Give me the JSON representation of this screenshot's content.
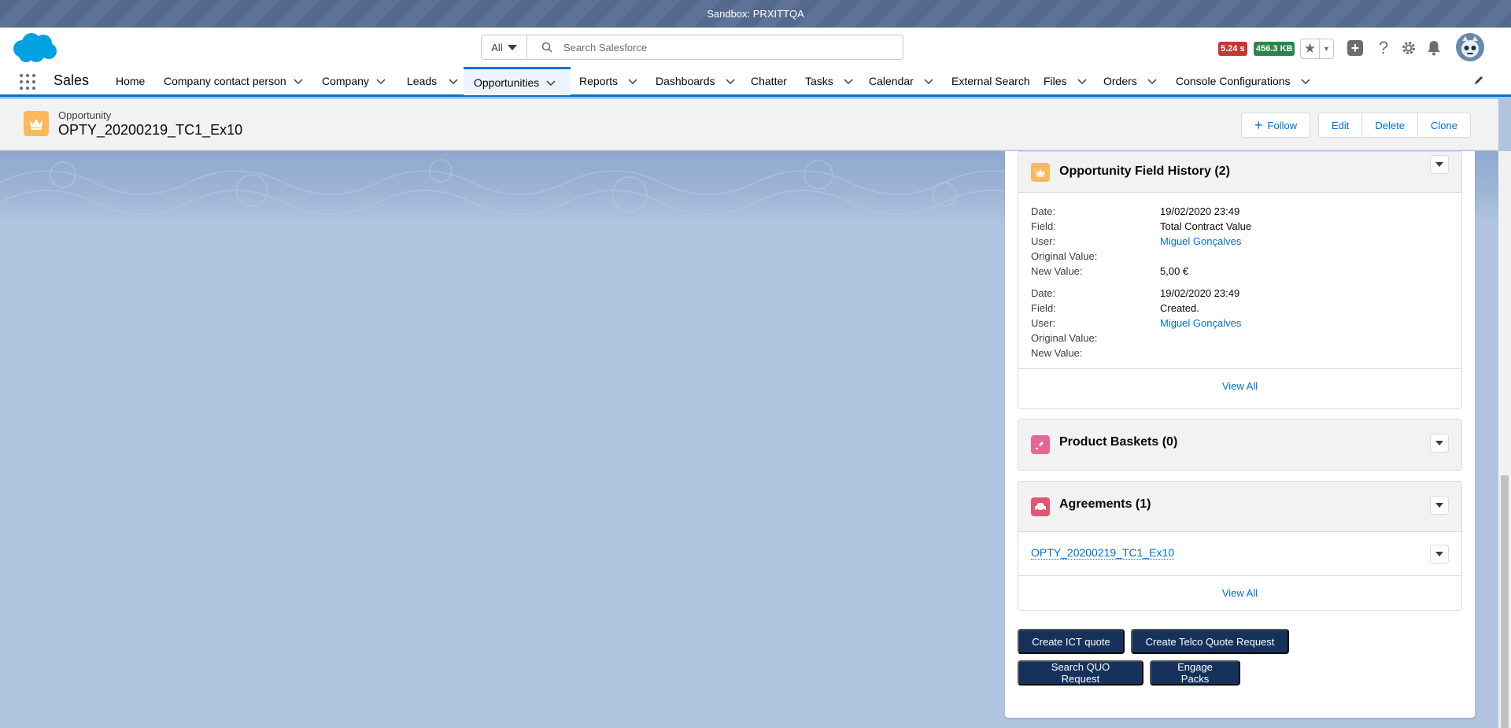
{
  "sandbox": {
    "label": "Sandbox: PRXITTQA"
  },
  "header": {
    "search_scope": "All",
    "search_placeholder": "Search Salesforce",
    "timing_badge": "5.24 s",
    "size_badge": "456.3 KB"
  },
  "nav": {
    "app_name": "Sales",
    "items": [
      {
        "label": "Home",
        "has_menu": false
      },
      {
        "label": "Company contact person",
        "has_menu": true
      },
      {
        "label": "Company",
        "has_menu": true
      },
      {
        "label": "Leads",
        "has_menu": true
      },
      {
        "label": "Opportunities",
        "has_menu": true,
        "active": true
      },
      {
        "label": "Reports",
        "has_menu": true
      },
      {
        "label": "Dashboards",
        "has_menu": true
      },
      {
        "label": "Chatter",
        "has_menu": false
      },
      {
        "label": "Tasks",
        "has_menu": true
      },
      {
        "label": "Calendar",
        "has_menu": true
      },
      {
        "label": "External Search",
        "has_menu": false
      },
      {
        "label": "Files",
        "has_menu": true
      },
      {
        "label": "Orders",
        "has_menu": true
      },
      {
        "label": "Console Configurations",
        "has_menu": true
      }
    ]
  },
  "record": {
    "object_type": "Opportunity",
    "name": "OPTY_20200219_TC1_Ex10",
    "follow_label": "Follow",
    "edit_label": "Edit",
    "delete_label": "Delete",
    "clone_label": "Clone"
  },
  "field_history": {
    "title": "Opportunity Field History (2)",
    "labels": {
      "date": "Date:",
      "field": "Field:",
      "user": "User:",
      "original": "Original Value:",
      "new": "New Value:"
    },
    "entries": [
      {
        "date": "19/02/2020 23:49",
        "field": "Total Contract Value",
        "user": "Miguel Gonçalves",
        "original": "",
        "new": "5,00 €"
      },
      {
        "date": "19/02/2020 23:49",
        "field": "Created.",
        "user": "Miguel Gonçalves",
        "original": "",
        "new": ""
      }
    ],
    "view_all": "View All"
  },
  "product_baskets": {
    "title": "Product Baskets (0)"
  },
  "agreements": {
    "title": "Agreements (1)",
    "item": "OPTY_20200219_TC1_Ex10",
    "view_all": "View All"
  },
  "actions": {
    "create_ict": "Create ICT quote",
    "create_telco": "Create Telco Quote Request",
    "search_quo": "Search QUO Request",
    "engage_packs": "Engage Packs"
  },
  "colors": {
    "brand": "#0070d2",
    "opportunity_icon": "#fcb95b",
    "basket_icon": "#e56798",
    "agreement_icon": "#e3566f",
    "action_button": "#16325c"
  }
}
